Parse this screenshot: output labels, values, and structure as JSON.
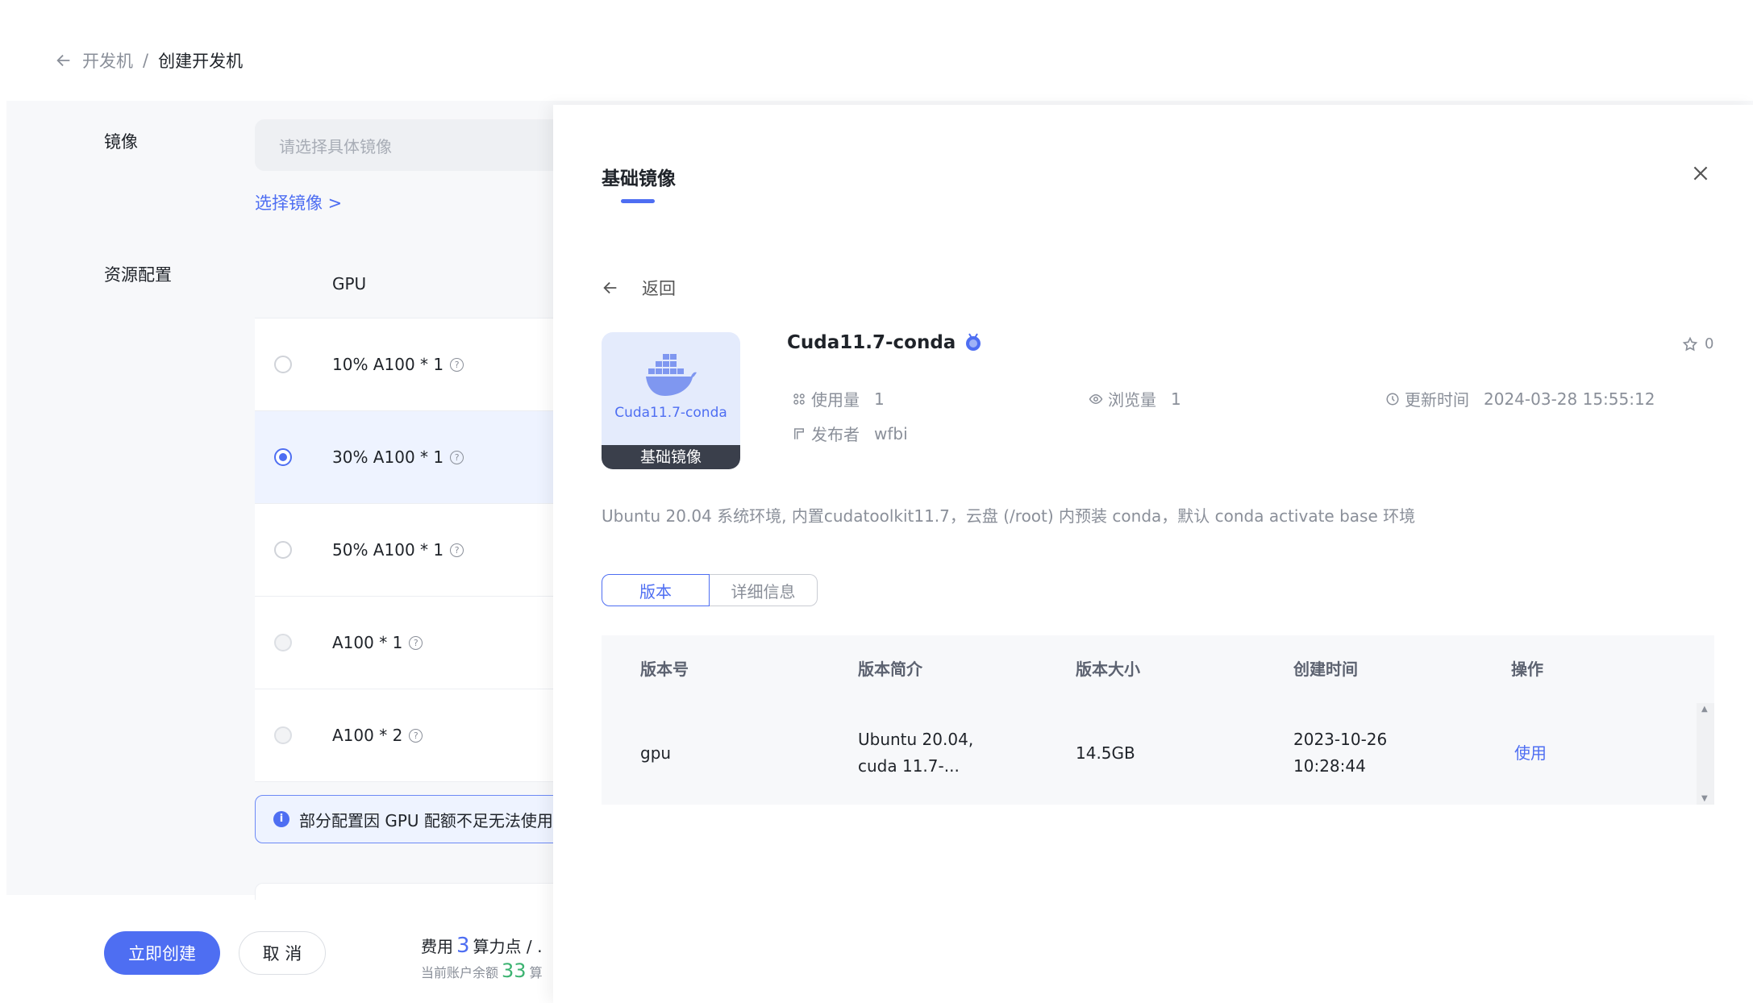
{
  "breadcrumb": {
    "parent": "开发机",
    "separator": "/",
    "current": "创建开发机"
  },
  "form": {
    "image_label": "镜像",
    "image_placeholder": "请选择具体镜像",
    "choose_image_link": "选择镜像 >",
    "resource_label": "资源配置",
    "gpu_header": "GPU",
    "gpu_options": [
      {
        "label": "10% A100 * 1",
        "state": "unselected"
      },
      {
        "label": "30% A100 * 1",
        "state": "selected"
      },
      {
        "label": "50% A100 * 1",
        "state": "unselected"
      },
      {
        "label": "A100 * 1",
        "state": "disabled"
      },
      {
        "label": "A100 * 2",
        "state": "disabled"
      }
    ],
    "notice": "部分配置因 GPU 配额不足无法使用"
  },
  "footer": {
    "create_button": "立即创建",
    "cancel_button": "取 消",
    "fee_prefix": "费用",
    "fee_value": "3",
    "fee_suffix": "算力点 / ․",
    "balance_prefix": "当前账户余额",
    "balance_value": "33",
    "balance_suffix": "算"
  },
  "drawer": {
    "title": "基础镜像",
    "back_label": "返回",
    "image": {
      "name": "Cuda11.7-conda",
      "thumb_name": "Cuda11.7-conda",
      "thumb_badge": "基础镜像",
      "star_count": "0",
      "usage_label": "使用量",
      "usage_value": "1",
      "views_label": "浏览量",
      "views_value": "1",
      "updated_label": "更新时间",
      "updated_value": "2024-03-28 15:55:12",
      "publisher_label": "发布者",
      "publisher_value": "wfbi",
      "description": "Ubuntu 20.04 系统环境, 内置cudatoolkit11.7，云盘 (/root) 内预装 conda，默认 conda activate base 环境"
    },
    "tabs": [
      "版本",
      "详细信息"
    ],
    "versions_table": {
      "headers": [
        "版本号",
        "版本简介",
        "版本大小",
        "创建时间",
        "操作"
      ],
      "rows": [
        {
          "version": "gpu",
          "intro_line1": "Ubuntu 20.04,",
          "intro_line2": "cuda 11.7-...",
          "size": "14.5GB",
          "created_line1": "2023-10-26",
          "created_line2": "10:28:44",
          "action": "使用"
        }
      ]
    }
  },
  "colors": {
    "accent": "#4e6ef2",
    "balance_green": "#3cb371",
    "thumb_bg": "#e4ebfc"
  }
}
